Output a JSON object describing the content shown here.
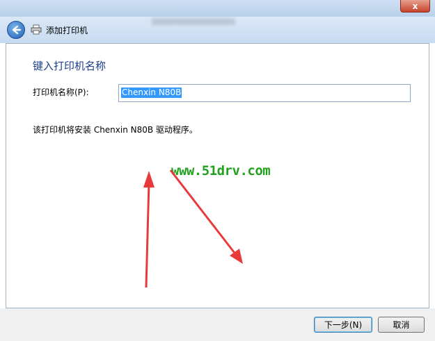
{
  "window": {
    "close_label": "x"
  },
  "header": {
    "title": "添加打印机"
  },
  "main": {
    "heading": "键入打印机名称",
    "printer_name_label": "打印机名称(P):",
    "printer_name_value": "Chenxin N80B",
    "info_text": "该打印机将安装 Chenxin N80B 驱动程序。"
  },
  "watermark": {
    "text": "www.51drv.com",
    "color": "#21a21e"
  },
  "annotations": {
    "arrow_color": "#e83a3a"
  },
  "footer": {
    "next_label": "下一步(N)",
    "cancel_label": "取消"
  },
  "icons": [
    "back-arrow-icon",
    "printer-icon",
    "close-icon"
  ]
}
